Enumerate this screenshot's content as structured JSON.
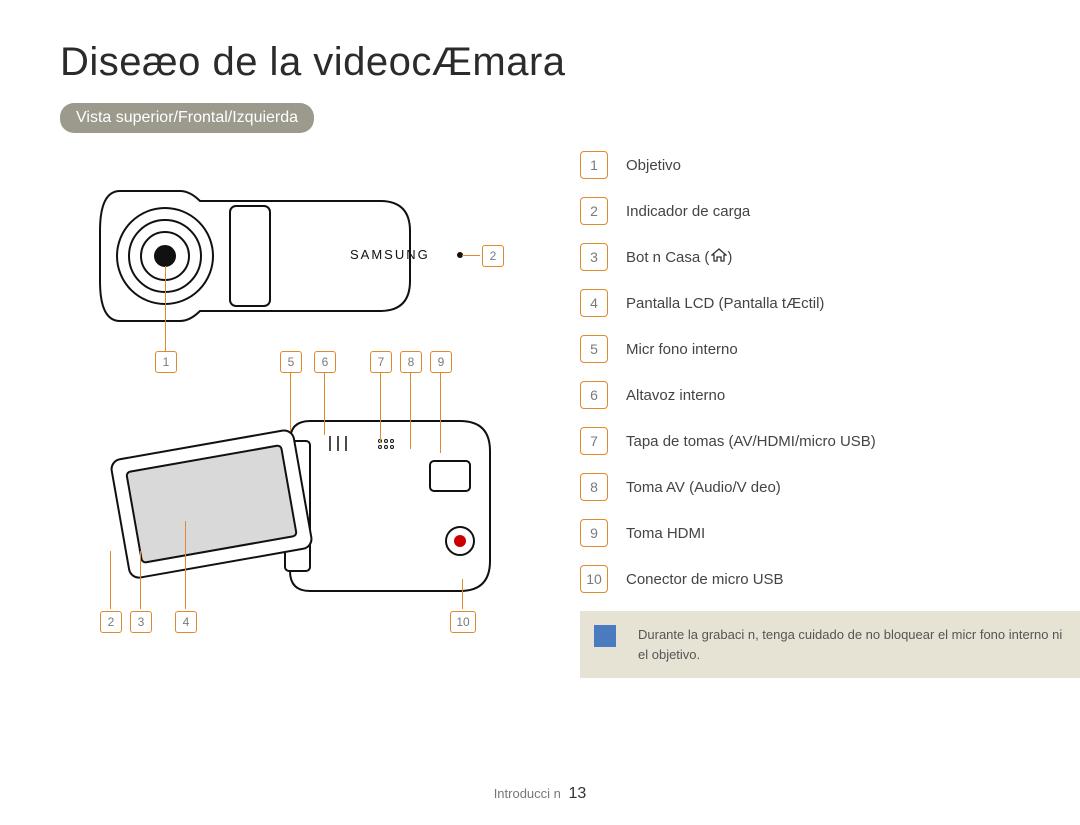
{
  "title": "Diseæo de la videocÆmara",
  "subtitle": "Vista superior/Frontal/Izquierda",
  "brand": "SAMSUNG",
  "callouts": [
    "1",
    "2",
    "3",
    "4",
    "5",
    "6",
    "7",
    "8",
    "9",
    "10"
  ],
  "legend": [
    {
      "n": "1",
      "label": "Objetivo"
    },
    {
      "n": "2",
      "label": "Indicador de carga"
    },
    {
      "n": "3",
      "label": "Bot n Casa (",
      "icon": "home",
      "tail": ")"
    },
    {
      "n": "4",
      "label": "Pantalla LCD (Pantalla tÆctil)"
    },
    {
      "n": "5",
      "label": "Micr fono interno"
    },
    {
      "n": "6",
      "label": "Altavoz interno"
    },
    {
      "n": "7",
      "label": "Tapa de tomas (AV/HDMI/micro USB)"
    },
    {
      "n": "8",
      "label": "Toma AV (Audio/V deo)"
    },
    {
      "n": "9",
      "label": "Toma HDMI"
    },
    {
      "n": "10",
      "label": "Conector de micro USB"
    }
  ],
  "note": "Durante la grabaci n, tenga cuidado de no bloquear el micr fono interno ni el objetivo.",
  "footer_section": "Introducci n",
  "page_number": "13"
}
